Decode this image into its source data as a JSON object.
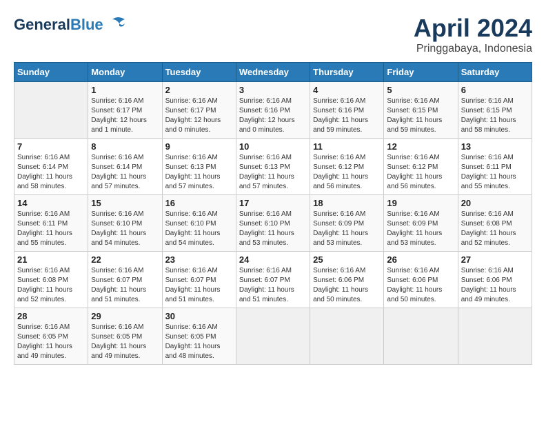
{
  "header": {
    "logo_line1": "General",
    "logo_line2": "Blue",
    "month": "April 2024",
    "location": "Pringgabaya, Indonesia"
  },
  "weekdays": [
    "Sunday",
    "Monday",
    "Tuesday",
    "Wednesday",
    "Thursday",
    "Friday",
    "Saturday"
  ],
  "weeks": [
    [
      {
        "day": "",
        "info": ""
      },
      {
        "day": "1",
        "info": "Sunrise: 6:16 AM\nSunset: 6:17 PM\nDaylight: 12 hours\nand 1 minute."
      },
      {
        "day": "2",
        "info": "Sunrise: 6:16 AM\nSunset: 6:17 PM\nDaylight: 12 hours\nand 0 minutes."
      },
      {
        "day": "3",
        "info": "Sunrise: 6:16 AM\nSunset: 6:16 PM\nDaylight: 12 hours\nand 0 minutes."
      },
      {
        "day": "4",
        "info": "Sunrise: 6:16 AM\nSunset: 6:16 PM\nDaylight: 11 hours\nand 59 minutes."
      },
      {
        "day": "5",
        "info": "Sunrise: 6:16 AM\nSunset: 6:15 PM\nDaylight: 11 hours\nand 59 minutes."
      },
      {
        "day": "6",
        "info": "Sunrise: 6:16 AM\nSunset: 6:15 PM\nDaylight: 11 hours\nand 58 minutes."
      }
    ],
    [
      {
        "day": "7",
        "info": "Sunrise: 6:16 AM\nSunset: 6:14 PM\nDaylight: 11 hours\nand 58 minutes."
      },
      {
        "day": "8",
        "info": "Sunrise: 6:16 AM\nSunset: 6:14 PM\nDaylight: 11 hours\nand 57 minutes."
      },
      {
        "day": "9",
        "info": "Sunrise: 6:16 AM\nSunset: 6:13 PM\nDaylight: 11 hours\nand 57 minutes."
      },
      {
        "day": "10",
        "info": "Sunrise: 6:16 AM\nSunset: 6:13 PM\nDaylight: 11 hours\nand 57 minutes."
      },
      {
        "day": "11",
        "info": "Sunrise: 6:16 AM\nSunset: 6:12 PM\nDaylight: 11 hours\nand 56 minutes."
      },
      {
        "day": "12",
        "info": "Sunrise: 6:16 AM\nSunset: 6:12 PM\nDaylight: 11 hours\nand 56 minutes."
      },
      {
        "day": "13",
        "info": "Sunrise: 6:16 AM\nSunset: 6:11 PM\nDaylight: 11 hours\nand 55 minutes."
      }
    ],
    [
      {
        "day": "14",
        "info": "Sunrise: 6:16 AM\nSunset: 6:11 PM\nDaylight: 11 hours\nand 55 minutes."
      },
      {
        "day": "15",
        "info": "Sunrise: 6:16 AM\nSunset: 6:10 PM\nDaylight: 11 hours\nand 54 minutes."
      },
      {
        "day": "16",
        "info": "Sunrise: 6:16 AM\nSunset: 6:10 PM\nDaylight: 11 hours\nand 54 minutes."
      },
      {
        "day": "17",
        "info": "Sunrise: 6:16 AM\nSunset: 6:10 PM\nDaylight: 11 hours\nand 53 minutes."
      },
      {
        "day": "18",
        "info": "Sunrise: 6:16 AM\nSunset: 6:09 PM\nDaylight: 11 hours\nand 53 minutes."
      },
      {
        "day": "19",
        "info": "Sunrise: 6:16 AM\nSunset: 6:09 PM\nDaylight: 11 hours\nand 53 minutes."
      },
      {
        "day": "20",
        "info": "Sunrise: 6:16 AM\nSunset: 6:08 PM\nDaylight: 11 hours\nand 52 minutes."
      }
    ],
    [
      {
        "day": "21",
        "info": "Sunrise: 6:16 AM\nSunset: 6:08 PM\nDaylight: 11 hours\nand 52 minutes."
      },
      {
        "day": "22",
        "info": "Sunrise: 6:16 AM\nSunset: 6:07 PM\nDaylight: 11 hours\nand 51 minutes."
      },
      {
        "day": "23",
        "info": "Sunrise: 6:16 AM\nSunset: 6:07 PM\nDaylight: 11 hours\nand 51 minutes."
      },
      {
        "day": "24",
        "info": "Sunrise: 6:16 AM\nSunset: 6:07 PM\nDaylight: 11 hours\nand 51 minutes."
      },
      {
        "day": "25",
        "info": "Sunrise: 6:16 AM\nSunset: 6:06 PM\nDaylight: 11 hours\nand 50 minutes."
      },
      {
        "day": "26",
        "info": "Sunrise: 6:16 AM\nSunset: 6:06 PM\nDaylight: 11 hours\nand 50 minutes."
      },
      {
        "day": "27",
        "info": "Sunrise: 6:16 AM\nSunset: 6:06 PM\nDaylight: 11 hours\nand 49 minutes."
      }
    ],
    [
      {
        "day": "28",
        "info": "Sunrise: 6:16 AM\nSunset: 6:05 PM\nDaylight: 11 hours\nand 49 minutes."
      },
      {
        "day": "29",
        "info": "Sunrise: 6:16 AM\nSunset: 6:05 PM\nDaylight: 11 hours\nand 49 minutes."
      },
      {
        "day": "30",
        "info": "Sunrise: 6:16 AM\nSunset: 6:05 PM\nDaylight: 11 hours\nand 48 minutes."
      },
      {
        "day": "",
        "info": ""
      },
      {
        "day": "",
        "info": ""
      },
      {
        "day": "",
        "info": ""
      },
      {
        "day": "",
        "info": ""
      }
    ]
  ]
}
